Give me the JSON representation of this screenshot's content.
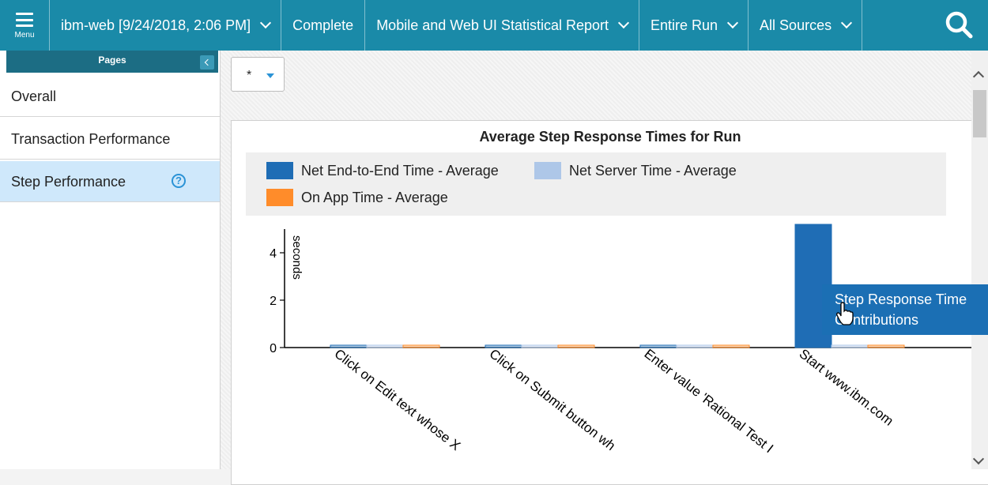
{
  "topbar": {
    "menu_label": "Menu",
    "items": [
      {
        "label": "ibm-web [9/24/2018, 2:06 PM]",
        "dropdown": true
      },
      {
        "label": "Complete",
        "dropdown": false
      },
      {
        "label": "Mobile and Web UI Statistical Report",
        "dropdown": true
      },
      {
        "label": "Entire Run",
        "dropdown": true
      },
      {
        "label": "All Sources",
        "dropdown": true
      }
    ],
    "search_icon": "search-icon",
    "color": "#1a8aa8"
  },
  "sidebar": {
    "header": "Pages",
    "items": [
      {
        "label": "Overall"
      },
      {
        "label": "Transaction Performance"
      },
      {
        "label": "Step Performance",
        "active": true,
        "help_icon": "?"
      }
    ]
  },
  "filter": {
    "value": "*"
  },
  "chart_data": {
    "type": "bar",
    "title": "Average Step Response Times for Run",
    "ylabel": "seconds",
    "xlabel": "",
    "ylim": [
      0,
      5
    ],
    "yticks": [
      "0",
      "2",
      "4"
    ],
    "categories": [
      "Click on Edit text whose X",
      "Click on Submit button wh",
      "Enter value 'Rational Test I",
      "Start www.ibm.com"
    ],
    "series": [
      {
        "name": "Net End-to-End Time - Average",
        "color": "#1f6db5",
        "values": [
          0,
          0,
          0,
          5.2
        ]
      },
      {
        "name": "Net Server Time - Average",
        "color": "#aec7e8",
        "values": [
          0,
          0,
          0,
          0
        ]
      },
      {
        "name": "On App Time - Average",
        "color": "#ff8c2a",
        "values": [
          0,
          0,
          0,
          0
        ]
      }
    ],
    "legend_position": "top"
  },
  "tooltip": {
    "line1": "Step Response Time",
    "line2": "Contributions"
  }
}
